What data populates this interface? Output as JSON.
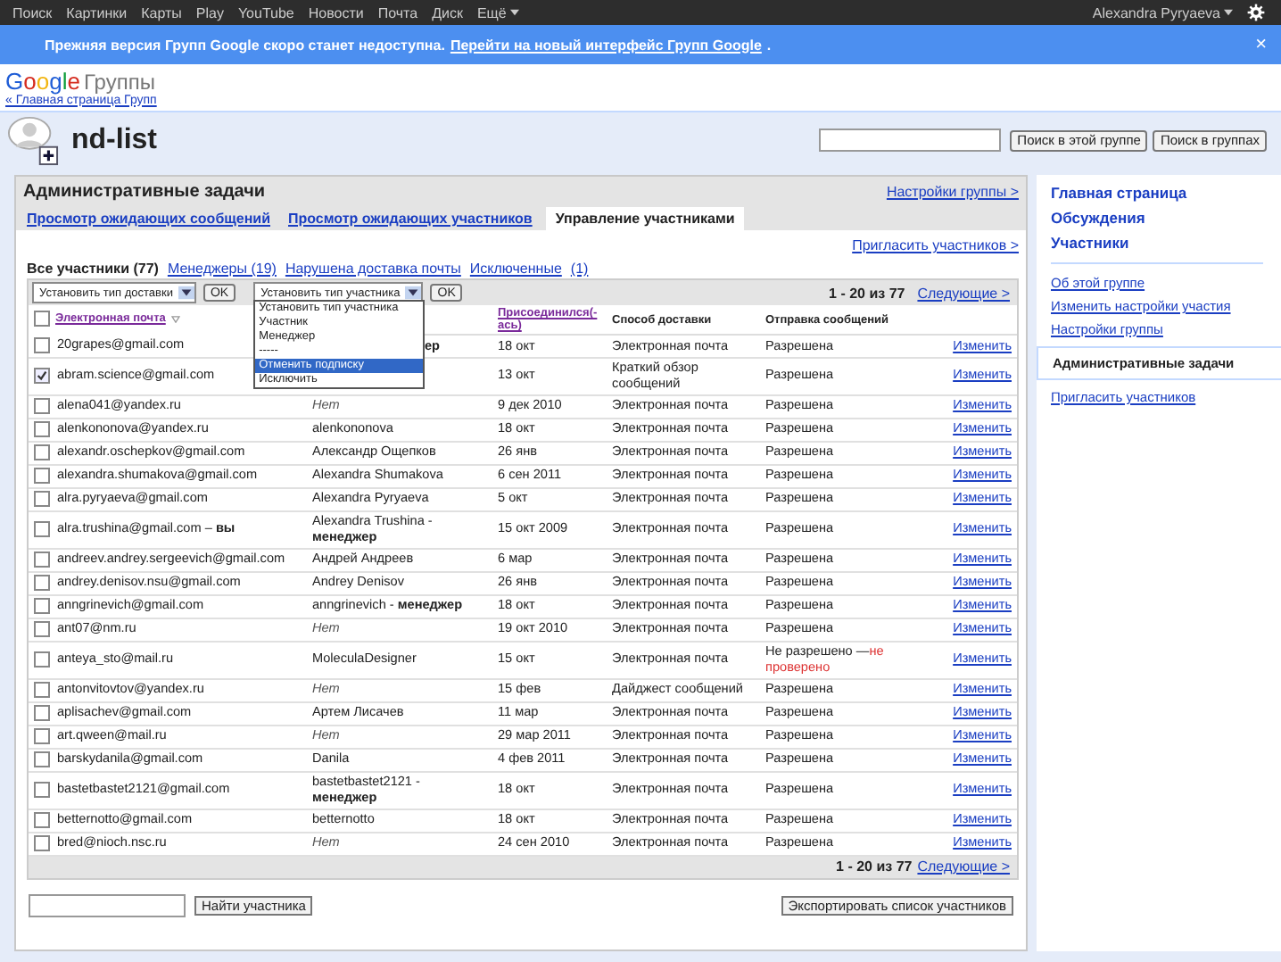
{
  "topbar": {
    "items": [
      "Поиск",
      "Картинки",
      "Карты",
      "Play",
      "YouTube",
      "Новости",
      "Почта",
      "Диск",
      "Ещё"
    ],
    "user": "Alexandra Pyryaeva"
  },
  "banner": {
    "text": "Прежняя версия Групп Google скоро станет недоступна.",
    "link": "Перейти на новый интерфейс Групп Google",
    "tail": ".",
    "close": "×"
  },
  "brand": {
    "logo": "Google",
    "product": "Группы",
    "back_link": "« Главная страница Групп"
  },
  "group": {
    "title": "nd-list",
    "search_buttons": [
      "Поиск в этой группе",
      "Поиск в группах"
    ]
  },
  "panel": {
    "title": "Административные задачи",
    "settings_link": "Настройки группы >",
    "tabs": [
      {
        "label": "Просмотр ожидающих сообщений",
        "selected": false
      },
      {
        "label": "Просмотр ожидающих участников",
        "selected": false
      },
      {
        "label": "Управление участниками",
        "selected": true
      }
    ],
    "invite_link": "Пригласить участников >",
    "filters": [
      {
        "label": "Все участники (77)",
        "selected": true
      },
      {
        "label": "Менеджеры (19)",
        "selected": false
      },
      {
        "label": "Нарушена доставка почты",
        "selected": false
      },
      {
        "label": "Исключенные",
        "selected": false
      },
      {
        "label": "(1)",
        "selected": false
      }
    ],
    "delivery_select": "Установить тип доставки",
    "member_select": "Установить тип участника",
    "ok_buttons": [
      "OK",
      "OK"
    ],
    "member_options": [
      {
        "label": "Установить тип участника",
        "selected": false
      },
      {
        "label": "Участник",
        "selected": false
      },
      {
        "label": "Менеджер",
        "selected": false
      },
      {
        "label": "-----",
        "selected": false
      },
      {
        "label": "Отменить подписку",
        "selected": true
      },
      {
        "label": "Исключить",
        "selected": false
      }
    ],
    "pager": {
      "range": "1 - 20 из 77",
      "next": "Следующие >"
    },
    "pager_bottom": {
      "range": "1 - 20 из 77",
      "next": "Следующие >"
    },
    "select_all_checked": false,
    "columns": {
      "email": "Электронная почта",
      "joined": "Присоединился(-ась)",
      "delivery": "Способ доставки",
      "posting": "Отправка сообщений"
    },
    "rows": [
      {
        "email": "20grapes@gmail.com",
        "checked": false,
        "name": "**ер**",
        "no_name": false,
        "covered": true,
        "joined": "18 окт",
        "delivery": "Электронная почта",
        "posting": "Разрешена",
        "action": "Изменить"
      },
      {
        "email": "abram.science@gmail.com",
        "checked": true,
        "joined": "13 окт",
        "delivery": "Краткий обзор сообщений",
        "posting": "Разрешена",
        "action": "Изменить"
      },
      {
        "email": "alena041@yandex.ru",
        "checked": false,
        "name": "Нет",
        "no_name": true,
        "joined": "9 дек 2010",
        "delivery": "Электронная почта",
        "posting": "Разрешена",
        "action": "Изменить"
      },
      {
        "email": "alenkononova@yandex.ru",
        "checked": false,
        "name": "alenkononova",
        "no_name": false,
        "joined": "18 окт",
        "delivery": "Электронная почта",
        "posting": "Разрешена",
        "action": "Изменить"
      },
      {
        "email": "alexandr.oschepkov@gmail.com",
        "checked": false,
        "name": "Александр Ощепков",
        "no_name": false,
        "joined": "26 янв",
        "delivery": "Электронная почта",
        "posting": "Разрешена",
        "action": "Изменить"
      },
      {
        "email": "alexandra.shumakova@gmail.com",
        "checked": false,
        "name": "Alexandra Shumakova",
        "no_name": false,
        "joined": "6 сен 2011",
        "delivery": "Электронная почта",
        "posting": "Разрешена",
        "action": "Изменить"
      },
      {
        "email": "alra.pyryaeva@gmail.com",
        "checked": false,
        "name": "Alexandra Pyryaeva",
        "no_name": false,
        "joined": "5 окт",
        "delivery": "Электронная почта",
        "posting": "Разрешена",
        "action": "Изменить"
      },
      {
        "email": "alra.trushina@gmail.com – **вы**",
        "checked": false,
        "name": "Alexandra Trushina  - **менеджер**",
        "no_name": false,
        "joined": "15 окт 2009",
        "delivery": "Электронная почта",
        "posting": "Разрешена",
        "action": "Изменить"
      },
      {
        "email": "andreev.andrey.sergeevich@gmail.com",
        "checked": false,
        "name": "Андрей Андреев",
        "no_name": false,
        "joined": "6 мар",
        "delivery": "Электронная почта",
        "posting": "Разрешена",
        "action": "Изменить"
      },
      {
        "email": "andrey.denisov.nsu@gmail.com",
        "checked": false,
        "name": "Andrey Denisov",
        "no_name": false,
        "joined": "26 янв",
        "delivery": "Электронная почта",
        "posting": "Разрешена",
        "action": "Изменить"
      },
      {
        "email": "anngrinevich@gmail.com",
        "checked": false,
        "name": "anngrinevich  - **менеджер**",
        "no_name": false,
        "joined": "18 окт",
        "delivery": "Электронная почта",
        "posting": "Разрешена",
        "action": "Изменить"
      },
      {
        "email": "ant07@nm.ru",
        "checked": false,
        "name": "Нет",
        "no_name": true,
        "joined": "19 окт 2010",
        "delivery": "Электронная почта",
        "posting": "Разрешена",
        "action": "Изменить"
      },
      {
        "email": "anteya_sto@mail.ru",
        "checked": false,
        "name": "MoleculaDesigner",
        "no_name": false,
        "joined": "15 окт",
        "delivery": "Электронная почта",
        "posting": "Не разрешено —",
        "posting_note": "не проверено",
        "action": "Изменить"
      },
      {
        "email": "antonvitovtov@yandex.ru",
        "checked": false,
        "name": "Нет",
        "no_name": true,
        "joined": "15 фев",
        "delivery": "Дайджест сообщений",
        "posting": "Разрешена",
        "action": "Изменить"
      },
      {
        "email": "aplisachev@gmail.com",
        "checked": false,
        "name": "Артем Лисачев",
        "no_name": false,
        "joined": "11 мар",
        "delivery": "Электронная почта",
        "posting": "Разрешена",
        "action": "Изменить"
      },
      {
        "email": "art.qween@mail.ru",
        "checked": false,
        "name": "Нет",
        "no_name": true,
        "joined": "29 мар 2011",
        "delivery": "Электронная почта",
        "posting": "Разрешена",
        "action": "Изменить"
      },
      {
        "email": "barskydanila@gmail.com",
        "checked": false,
        "name": "Danila",
        "no_name": false,
        "joined": "4 фев 2011",
        "delivery": "Электронная почта",
        "posting": "Разрешена",
        "action": "Изменить"
      },
      {
        "email": "bastetbastet2121@gmail.com",
        "checked": false,
        "name": "bastetbastet2121  - **менеджер**",
        "no_name": false,
        "joined": "18 окт",
        "delivery": "Электронная почта",
        "posting": "Разрешена",
        "action": "Изменить"
      },
      {
        "email": "betternotto@gmail.com",
        "checked": false,
        "name": "betternotto",
        "no_name": false,
        "joined": "18 окт",
        "delivery": "Электронная почта",
        "posting": "Разрешена",
        "action": "Изменить"
      },
      {
        "email": "bred@nioch.nsc.ru",
        "checked": false,
        "name": "Нет",
        "no_name": true,
        "joined": "24 сен 2010",
        "delivery": "Электронная почта",
        "posting": "Разрешена",
        "action": "Изменить"
      }
    ],
    "find_button": "Найти участника",
    "export_button": "Экспортировать список участников"
  },
  "sidebar": {
    "main_links": [
      "Главная страница",
      "Обсуждения",
      "Участники"
    ],
    "items": [
      {
        "label": "Об этой группе",
        "selected": false
      },
      {
        "label": "Изменить настройки участия",
        "selected": false
      },
      {
        "label": "Настройки группы",
        "selected": false
      },
      {
        "label": "Административные задачи",
        "selected": true
      },
      {
        "label": "Пригласить участников",
        "selected": false
      }
    ]
  }
}
